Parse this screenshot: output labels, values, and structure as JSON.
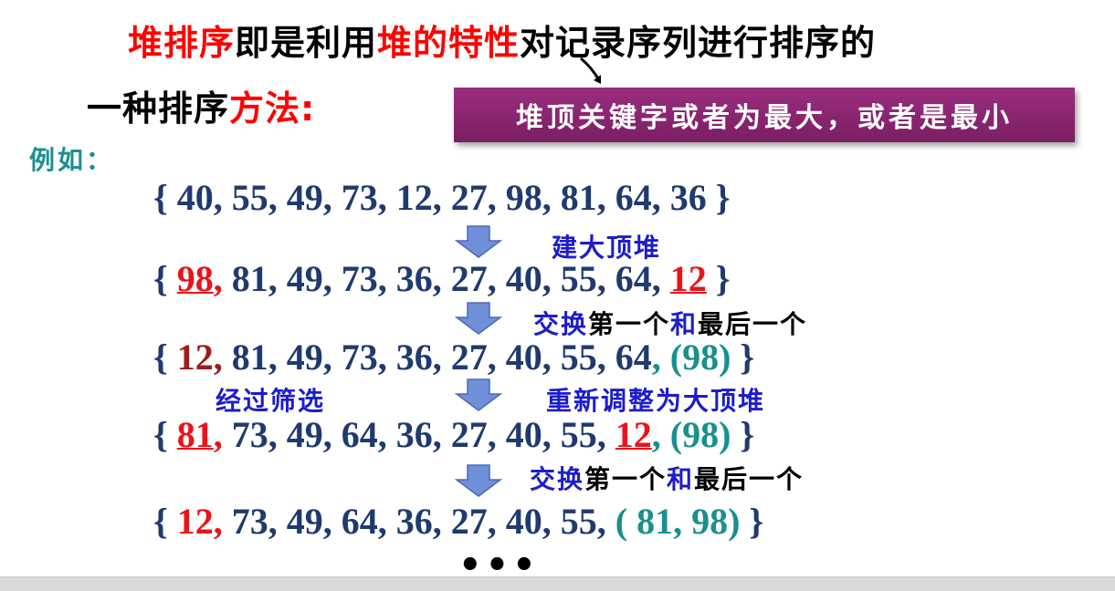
{
  "title": {
    "l1_a": "堆排序",
    "l1_b": "即是利用",
    "l1_c": "堆的特性",
    "l1_d": "对记录序列进行排序的",
    "l2_a": "一种排序",
    "l2_b": "方法:"
  },
  "callout": {
    "text": "堆顶关键字或者为最大，或者是最小"
  },
  "example_label": "例如：",
  "rows": {
    "r0": {
      "open": "{ ",
      "body": "40, 55, 49, 73, 12, 27, 98, 81, 64, 36",
      "close": " }"
    },
    "r1": {
      "open": "{ ",
      "h1": "98",
      "h1c": ",",
      "body": " 81, 49, 73, 36, 27, 40, 55, 64, ",
      "h2": "12",
      "close": " }"
    },
    "r2": {
      "open": "{ ",
      "h1": "12",
      "h1c": ",",
      "body": " 81, 49, 73, 36, 27, 40, 55, 64",
      "tail": ", (98)",
      "close": " }"
    },
    "r3": {
      "open": "{ ",
      "h1": "81",
      "h1c": ",",
      "body": " 73, 49, 64, 36, 27, 40, 55, ",
      "h2": "12",
      "tail": ", (98)",
      "close": " }"
    },
    "r4": {
      "open": "{ ",
      "h1": "12",
      "h1c": ",",
      "body": " 73, 49, 64, 36, 27, 40, 55, ",
      "tail": "( 81, 98)",
      "close": " }"
    }
  },
  "notes": {
    "build": "建大顶堆",
    "swap1_a": "交换",
    "swap1_b": "第一个",
    "swap1_c": "和",
    "swap1_d": "最后一个",
    "sift": "经过筛选",
    "readjust": "重新调整为大顶堆",
    "swap2_a": "交换",
    "swap2_b": "第一个",
    "swap2_c": "和",
    "swap2_d": "最后一个"
  },
  "ellipsis": "•••",
  "colors": {
    "red": "#ff0000",
    "navy": "#1f3a6e",
    "teal": "#1a8f8f",
    "callout": "#8a2570",
    "note_blue": "#1c1ccc",
    "arrow": "#6f8fd8"
  }
}
